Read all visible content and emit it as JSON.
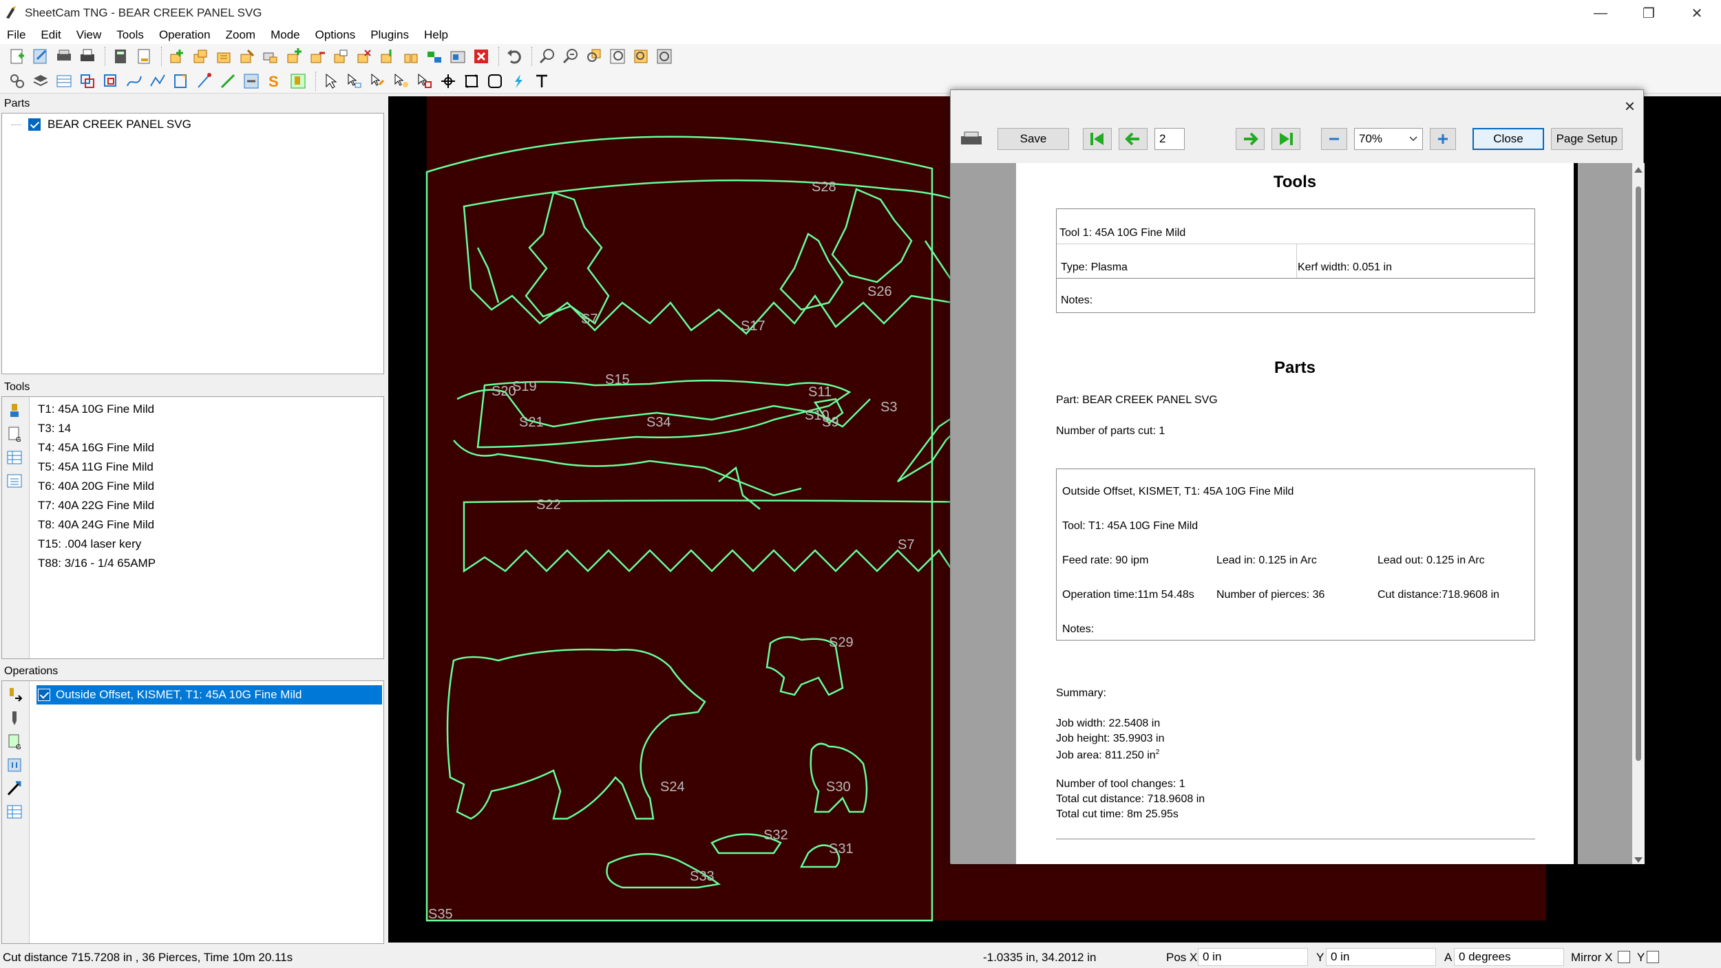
{
  "window": {
    "title": "SheetCam TNG - BEAR CREEK PANEL SVG",
    "minimize": "—",
    "maximize": "❐",
    "close": "✕"
  },
  "menu": [
    "File",
    "Edit",
    "View",
    "Tools",
    "Operation",
    "Zoom",
    "Mode",
    "Options",
    "Plugins",
    "Help"
  ],
  "parts": {
    "title": "Parts",
    "items": [
      {
        "label": "BEAR CREEK PANEL SVG",
        "checked": true
      }
    ]
  },
  "tools": {
    "title": "Tools",
    "items": [
      "T1: 45A 10G Fine Mild",
      "T3: 14",
      "T4: 45A 16G Fine Mild",
      "T5: 45A 11G Fine Mild",
      "T6: 40A 20G Fine Mild",
      "T7: 40A 22G Fine Mild",
      "T8: 40A 24G Fine Mild",
      "T15: .004 laser kery",
      "T88: 3/16 - 1/4 65AMP"
    ]
  },
  "operations": {
    "title": "Operations",
    "items": [
      {
        "label": "Outside Offset, KISMET, T1: 45A 10G Fine Mild",
        "checked": true,
        "selected": true
      }
    ]
  },
  "canvas": {
    "labels": [
      "S28",
      "S26",
      "S7",
      "S17",
      "S19",
      "S20",
      "S15",
      "S21",
      "S34",
      "S11",
      "S10",
      "S9",
      "S3",
      "S22",
      "S7",
      "S29",
      "S24",
      "S30",
      "S32",
      "S31",
      "S33",
      "S35"
    ]
  },
  "dialog": {
    "close": "×",
    "save": "Save",
    "page_number": "2",
    "zoom": "70%",
    "close_button": "Close",
    "page_setup": "Page Setup",
    "report": {
      "tools_heading": "Tools",
      "tool_name": "Tool 1: 45A 10G Fine Mild",
      "tool_type": "Type: Plasma",
      "kerf": "Kerf width: 0.051 in",
      "tool_notes": "Notes:",
      "parts_heading": "Parts",
      "part": "Part: BEAR CREEK PANEL SVG",
      "parts_cut": "Number of parts cut: 1",
      "op_title": "Outside Offset, KISMET, T1: 45A 10G Fine Mild",
      "op_tool": "Tool: T1: 45A 10G Fine Mild",
      "feed": "Feed rate: 90 ipm",
      "lead_in": "Lead in: 0.125 in Arc",
      "lead_out": "Lead out: 0.125 in Arc",
      "op_time": "Operation time:11m 54.48s",
      "pierces": "Number of pierces: 36",
      "cut_distance": "Cut distance:718.9608 in",
      "op_notes": "Notes:",
      "summary": "Summary:",
      "job_width": "Job width: 22.5408 in",
      "job_height": "Job height: 35.9903 in",
      "job_area": "Job area: 811.250 in",
      "job_area_sup": "2",
      "tool_changes": "Number of tool changes: 1",
      "total_cut_distance": "Total cut distance: 718.9608 in",
      "total_cut_time": "Total cut time: 8m 25.95s"
    }
  },
  "status": {
    "info": "Cut distance 715.7208 in , 36 Pierces, Time 10m 20.11s",
    "coords": "-1.0335 in, 34.2012 in",
    "pos_x_label": "Pos X",
    "pos_x": "0 in",
    "y_label": "Y",
    "y": "0 in",
    "a_label": "A",
    "a": "0 degrees",
    "mirror_x": "Mirror X",
    "mirror_y": "Y"
  },
  "colors": {
    "canvas_bg": "#000000",
    "sheet": "#3a0000",
    "geometry": "#66ff99",
    "selection": "#0078d7"
  }
}
